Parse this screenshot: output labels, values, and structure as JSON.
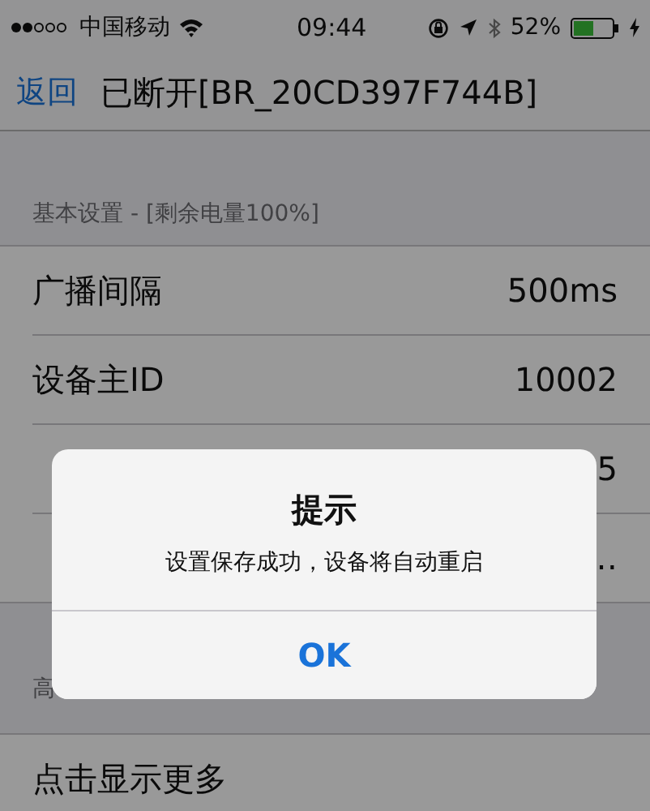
{
  "status_bar": {
    "carrier": "中国移动",
    "time": "09:44",
    "battery_percent": "52%"
  },
  "nav": {
    "back": "返回",
    "title": "已断开[BR_20CD397F744B]"
  },
  "sections": [
    {
      "header": "基本设置 - [剩余电量100%]",
      "rows": [
        {
          "label": "广播间隔",
          "value": "500ms"
        },
        {
          "label": "设备主ID",
          "value": "10002"
        },
        {
          "value": "5"
        },
        {
          "value": "…"
        }
      ]
    },
    {
      "header": "高",
      "rows": [
        {
          "label": "点击显示更多"
        }
      ]
    }
  ],
  "alert": {
    "title": "提示",
    "message": "设置保存成功，设备将自动重启",
    "buttons": [
      "OK"
    ]
  }
}
